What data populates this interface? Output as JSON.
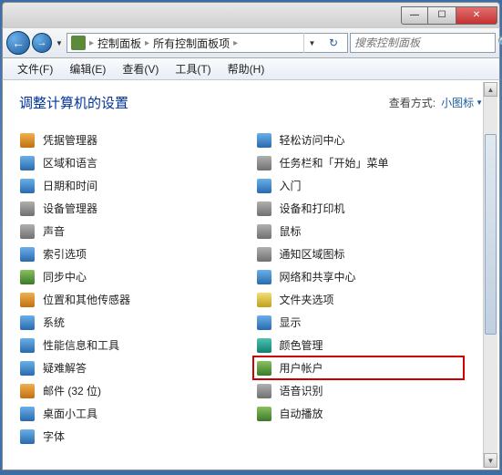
{
  "titlebar": {
    "min": "—",
    "max": "☐",
    "close": "✕"
  },
  "nav": {
    "back": "←",
    "forward": "→",
    "dropdown": "▼",
    "refresh": "↻"
  },
  "address": {
    "seg1": "控制面板",
    "seg2": "所有控制面板项",
    "sep": "▸"
  },
  "search": {
    "placeholder": "搜索控制面板",
    "icon": "🔍"
  },
  "menu": {
    "file": "文件(F)",
    "edit": "编辑(E)",
    "view": "查看(V)",
    "tools": "工具(T)",
    "help": "帮助(H)"
  },
  "header": {
    "title": "调整计算机的设置",
    "view_label": "查看方式:",
    "view_value": "小图标",
    "tri": "▼"
  },
  "items_left": [
    {
      "name": "credential-manager",
      "label": "凭据管理器",
      "ic": "ic-orange"
    },
    {
      "name": "region-language",
      "label": "区域和语言",
      "ic": "ic-blue"
    },
    {
      "name": "date-time",
      "label": "日期和时间",
      "ic": "ic-blue"
    },
    {
      "name": "device-manager",
      "label": "设备管理器",
      "ic": "ic-gray"
    },
    {
      "name": "sound",
      "label": "声音",
      "ic": "ic-gray"
    },
    {
      "name": "indexing-options",
      "label": "索引选项",
      "ic": "ic-blue"
    },
    {
      "name": "sync-center",
      "label": "同步中心",
      "ic": "ic-green"
    },
    {
      "name": "location-sensors",
      "label": "位置和其他传感器",
      "ic": "ic-orange"
    },
    {
      "name": "system",
      "label": "系统",
      "ic": "ic-blue"
    },
    {
      "name": "performance-tools",
      "label": "性能信息和工具",
      "ic": "ic-blue"
    },
    {
      "name": "troubleshooting",
      "label": "疑难解答",
      "ic": "ic-blue"
    },
    {
      "name": "mail-32bit",
      "label": "邮件 (32 位)",
      "ic": "ic-orange"
    },
    {
      "name": "desktop-gadgets",
      "label": "桌面小工具",
      "ic": "ic-blue"
    },
    {
      "name": "fonts",
      "label": "字体",
      "ic": "ic-blue"
    }
  ],
  "items_right": [
    {
      "name": "ease-of-access",
      "label": "轻松访问中心",
      "ic": "ic-blue"
    },
    {
      "name": "taskbar-start",
      "label": "任务栏和「开始」菜单",
      "ic": "ic-gray"
    },
    {
      "name": "getting-started",
      "label": "入门",
      "ic": "ic-blue"
    },
    {
      "name": "devices-printers",
      "label": "设备和打印机",
      "ic": "ic-gray"
    },
    {
      "name": "mouse",
      "label": "鼠标",
      "ic": "ic-gray"
    },
    {
      "name": "notification-icons",
      "label": "通知区域图标",
      "ic": "ic-gray"
    },
    {
      "name": "network-sharing",
      "label": "网络和共享中心",
      "ic": "ic-blue"
    },
    {
      "name": "folder-options",
      "label": "文件夹选项",
      "ic": "ic-yellow"
    },
    {
      "name": "display",
      "label": "显示",
      "ic": "ic-blue"
    },
    {
      "name": "color-management",
      "label": "颜色管理",
      "ic": "ic-teal"
    },
    {
      "name": "user-accounts",
      "label": "用户帐户",
      "ic": "ic-green",
      "highlight": true
    },
    {
      "name": "speech-recognition",
      "label": "语音识别",
      "ic": "ic-gray"
    },
    {
      "name": "autoplay",
      "label": "自动播放",
      "ic": "ic-green"
    }
  ]
}
